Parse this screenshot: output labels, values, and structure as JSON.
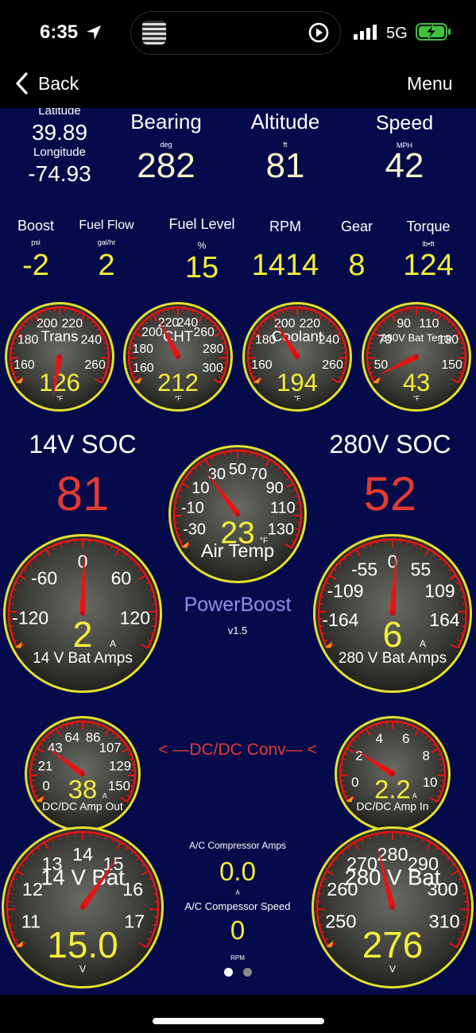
{
  "status_bar": {
    "time": "6:35",
    "network": "5G",
    "icons": [
      "location-arrow-icon",
      "signal-bars-icon",
      "battery-charging-icon",
      "play-circle-icon"
    ]
  },
  "nav": {
    "back_label": "Back",
    "menu_label": "Menu"
  },
  "top_readouts": {
    "latitude_label": "Latitude",
    "latitude_value": "39.89",
    "longitude_label": "Longitude",
    "longitude_value": "-74.93",
    "bearing_label": "Bearing",
    "bearing_unit": "deg",
    "bearing_value": "282",
    "altitude_label": "Altitude",
    "altitude_unit": "ft",
    "altitude_value": "81",
    "speed_label": "Speed",
    "speed_unit": "MPH",
    "speed_value": "42"
  },
  "mid_readouts": [
    {
      "label": "Boost",
      "unit": "psi",
      "value": "-2"
    },
    {
      "label": "Fuel Flow",
      "unit": "gal/hr",
      "value": "2"
    },
    {
      "label": "Fuel Level",
      "unit": "%",
      "value": "15"
    },
    {
      "label": "RPM",
      "unit": "",
      "value": "1414"
    },
    {
      "label": "Gear",
      "unit": "",
      "value": "8"
    },
    {
      "label": "Torque",
      "unit": "lb•ft",
      "value": "124"
    }
  ],
  "soc": {
    "v14_label": "14V SOC",
    "v14_value": "81",
    "v280_label": "280V SOC",
    "v280_value": "52"
  },
  "brand": {
    "name": "PowerBoost",
    "version": "v1.5"
  },
  "dcdc_label": "< —DC/DC  Conv— <",
  "ac": {
    "amps_label": "A/C Compressor  Amps",
    "amps_value": "0.0",
    "amps_unit": "A",
    "speed_label": "A/C Compessor Speed",
    "speed_value": "0",
    "speed_unit": "RPM"
  },
  "pager": {
    "pages": 2,
    "current": 1
  },
  "colors": {
    "background": "#050b4a",
    "value_yellow": "#f3ee3a",
    "soc_red": "#e23a33",
    "needle_red": "#e81414",
    "bezel_yellow": "#e4e030",
    "brand_blue": "#8f8ff0"
  },
  "gauges": [
    {
      "id": "trans",
      "title": "Trans",
      "unit": "°F",
      "value_text": "126",
      "value": 126,
      "min": 150,
      "max": 270,
      "ticks": [
        "160",
        "180",
        "200",
        "220",
        "240",
        "260"
      ]
    },
    {
      "id": "cht",
      "title": "CHT",
      "unit": "°F",
      "value_text": "212",
      "value": 212,
      "min": 150,
      "max": 310,
      "ticks": [
        "160",
        "180",
        "200",
        "220",
        "240",
        "260",
        "280",
        "300"
      ]
    },
    {
      "id": "coolant",
      "title": "Coolant",
      "unit": "°F",
      "value_text": "194",
      "value": 194,
      "min": 150,
      "max": 270,
      "ticks": [
        "160",
        "180",
        "200",
        "220",
        "240",
        "260"
      ]
    },
    {
      "id": "bat280temp",
      "title": "280V Bat Temp",
      "unit": "°F",
      "value_text": "43",
      "value": 43,
      "min": 40,
      "max": 160,
      "ticks": [
        "50",
        "70",
        "90",
        "110",
        "130",
        "150"
      ]
    },
    {
      "id": "airtemp",
      "title": "Air Temp",
      "unit": "°F",
      "value_text": "23",
      "value": 23,
      "min": -40,
      "max": 140,
      "ticks": [
        "-30",
        "-10",
        "10",
        "30",
        "50",
        "70",
        "90",
        "110",
        "130"
      ]
    },
    {
      "id": "bat14amps",
      "title": "14 V Bat Amps",
      "unit": "A",
      "value_text": "2",
      "value": 2,
      "min": -150,
      "max": 150,
      "ticks": [
        "-120",
        "-60",
        "0",
        "60",
        "120"
      ]
    },
    {
      "id": "bat280amps",
      "title": "280 V Bat Amps",
      "unit": "A",
      "value_text": "6",
      "value": 6,
      "min": -200,
      "max": 200,
      "ticks": [
        "-164",
        "-109",
        "-55",
        "0",
        "55",
        "109",
        "164"
      ]
    },
    {
      "id": "dcdcout",
      "title": "DC/DC Amp Out",
      "unit": "A",
      "value_text": "38",
      "value": 38,
      "min": -10,
      "max": 160,
      "ticks": [
        "0",
        "21",
        "43",
        "64",
        "86",
        "107",
        "129",
        "150"
      ]
    },
    {
      "id": "dcdcin",
      "title": "DC/DC Amp In",
      "unit": "A",
      "value_text": "2.2",
      "value": 2.2,
      "min": -1,
      "max": 11,
      "ticks": [
        "0",
        "2",
        "4",
        "6",
        "8",
        "10"
      ]
    },
    {
      "id": "bat14v",
      "title": "14 V Bat",
      "unit": "V",
      "value_text": "15.0",
      "value": 15.0,
      "min": 10.5,
      "max": 17.5,
      "ticks": [
        "11",
        "12",
        "13",
        "14",
        "15",
        "16",
        "17"
      ]
    },
    {
      "id": "bat280v",
      "title": "280 V Bat",
      "unit": "V",
      "value_text": "276",
      "value": 276,
      "min": 245,
      "max": 315,
      "ticks": [
        "250",
        "260",
        "270",
        "280",
        "290",
        "300",
        "310"
      ]
    }
  ]
}
